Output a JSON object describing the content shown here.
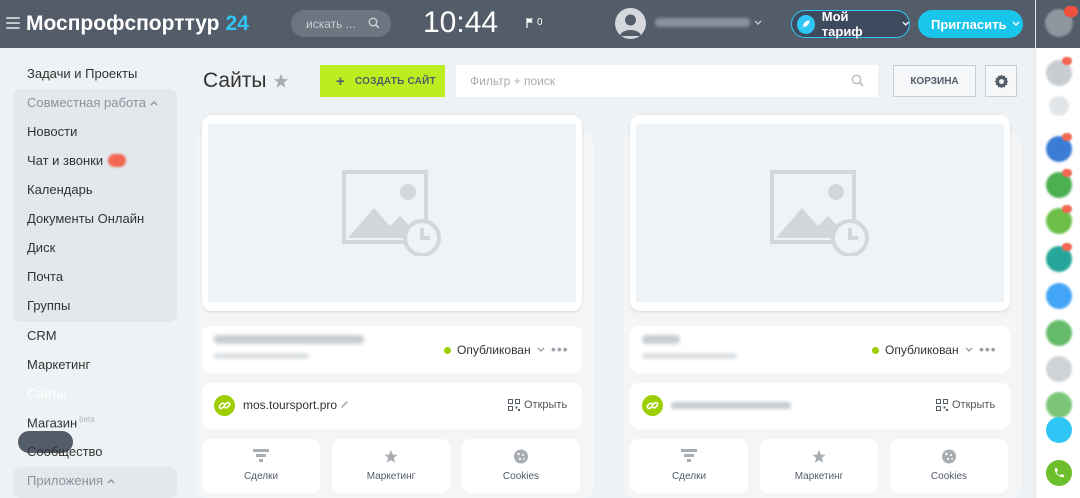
{
  "header": {
    "logo_text": "Моспрофспорттур",
    "logo_number": "24",
    "search_placeholder": "искать ...",
    "clock": "10:44",
    "flag_count": "0",
    "tariff_label": "Мой тариф",
    "invite_label": "Пригласить"
  },
  "sidebar": {
    "items": [
      {
        "label": "Задачи и Проекты"
      },
      {
        "label": "Совместная работа"
      },
      {
        "label": "Новости"
      },
      {
        "label": "Чат и звонки"
      },
      {
        "label": "Календарь"
      },
      {
        "label": "Документы Онлайн"
      },
      {
        "label": "Диск"
      },
      {
        "label": "Почта"
      },
      {
        "label": "Группы"
      },
      {
        "label": "CRM"
      },
      {
        "label": "Маркетинг"
      },
      {
        "label": "Сайты"
      },
      {
        "label": "Магазин"
      },
      {
        "label": "Сообщество"
      },
      {
        "label": "Приложения"
      }
    ],
    "shop_badge": "beta"
  },
  "page": {
    "title": "Сайты",
    "create_label": "СОЗДАТЬ САЙТ",
    "create_plus": "+",
    "filter_placeholder": "Фильтр + поиск",
    "trash_label": "КОРЗИНА"
  },
  "cards": [
    {
      "status": "Опубликован",
      "domain": "mos.toursport.pro",
      "open_label": "Открыть",
      "tiles": [
        "Сделки",
        "Маркетинг",
        "Cookies"
      ]
    },
    {
      "status": "Опубликован",
      "domain": "",
      "open_label": "Открыть",
      "tiles": [
        "Сделки",
        "Маркетинг",
        "Cookies"
      ]
    }
  ],
  "colors": {
    "header_bg": "#535c69",
    "accent_blue": "#2fc6f6",
    "create_green": "#bbed21",
    "published_dot": "#9dcf00"
  }
}
